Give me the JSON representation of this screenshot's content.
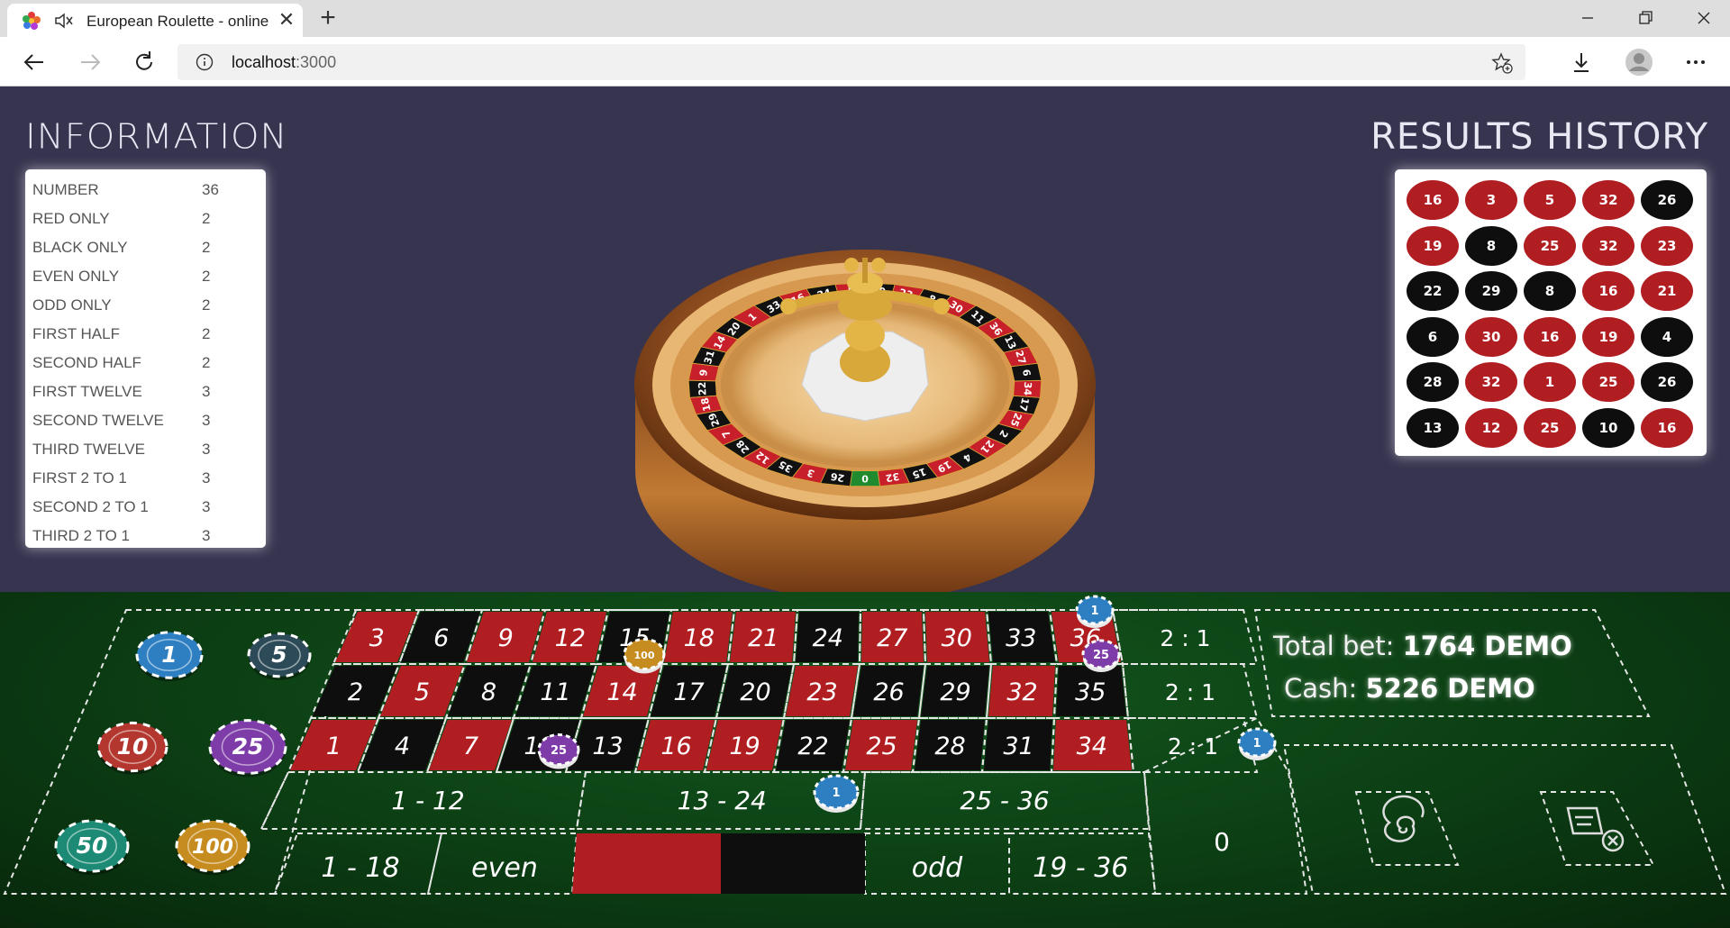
{
  "browser": {
    "tab_title": "European Roulette - online",
    "url_host": "localhost",
    "url_port": ":3000"
  },
  "information": {
    "title": "INFORMATION",
    "rows": [
      {
        "label": "NUMBER",
        "value": "36"
      },
      {
        "label": "RED ONLY",
        "value": "2"
      },
      {
        "label": "BLACK ONLY",
        "value": "2"
      },
      {
        "label": "EVEN ONLY",
        "value": "2"
      },
      {
        "label": "ODD ONLY",
        "value": "2"
      },
      {
        "label": "FIRST HALF",
        "value": "2"
      },
      {
        "label": "SECOND HALF",
        "value": "2"
      },
      {
        "label": "FIRST TWELVE",
        "value": "3"
      },
      {
        "label": "SECOND TWELVE",
        "value": "3"
      },
      {
        "label": "THIRD TWELVE",
        "value": "3"
      },
      {
        "label": "FIRST 2 TO 1",
        "value": "3"
      },
      {
        "label": "SECOND 2 TO 1",
        "value": "3"
      },
      {
        "label": "THIRD 2 TO 1",
        "value": "3"
      }
    ]
  },
  "results_history": {
    "title": "RESULTS HISTORY",
    "rows": [
      [
        {
          "n": "16",
          "c": "red"
        },
        {
          "n": "3",
          "c": "red"
        },
        {
          "n": "5",
          "c": "red"
        },
        {
          "n": "32",
          "c": "red"
        },
        {
          "n": "26",
          "c": "black"
        }
      ],
      [
        {
          "n": "19",
          "c": "red"
        },
        {
          "n": "8",
          "c": "black"
        },
        {
          "n": "25",
          "c": "red"
        },
        {
          "n": "32",
          "c": "red"
        },
        {
          "n": "23",
          "c": "red"
        }
      ],
      [
        {
          "n": "22",
          "c": "black"
        },
        {
          "n": "29",
          "c": "black"
        },
        {
          "n": "8",
          "c": "black"
        },
        {
          "n": "16",
          "c": "red"
        },
        {
          "n": "21",
          "c": "red"
        }
      ],
      [
        {
          "n": "6",
          "c": "black"
        },
        {
          "n": "30",
          "c": "red"
        },
        {
          "n": "16",
          "c": "red"
        },
        {
          "n": "19",
          "c": "red"
        },
        {
          "n": "4",
          "c": "black"
        }
      ],
      [
        {
          "n": "28",
          "c": "black"
        },
        {
          "n": "32",
          "c": "red"
        },
        {
          "n": "1",
          "c": "red"
        },
        {
          "n": "25",
          "c": "red"
        },
        {
          "n": "26",
          "c": "black"
        }
      ],
      [
        {
          "n": "13",
          "c": "black"
        },
        {
          "n": "12",
          "c": "red"
        },
        {
          "n": "25",
          "c": "red"
        },
        {
          "n": "10",
          "c": "black"
        },
        {
          "n": "16",
          "c": "red"
        }
      ]
    ]
  },
  "wheel": {
    "numbers_visible": [
      "0",
      "32",
      "15",
      "19",
      "4",
      "21",
      "2",
      "25",
      "17",
      "34",
      "6",
      "27",
      "13",
      "36",
      "11",
      "30",
      "8",
      "23",
      "10",
      "5",
      "24",
      "16",
      "33",
      "1",
      "20",
      "14",
      "31",
      "9",
      "22",
      "18",
      "29",
      "7",
      "28",
      "12",
      "35",
      "3",
      "26"
    ]
  },
  "table": {
    "rows": [
      [
        {
          "n": "3",
          "c": "red"
        },
        {
          "n": "6",
          "c": "black"
        },
        {
          "n": "9",
          "c": "red"
        },
        {
          "n": "12",
          "c": "red"
        },
        {
          "n": "15",
          "c": "black"
        },
        {
          "n": "18",
          "c": "red"
        },
        {
          "n": "21",
          "c": "red"
        },
        {
          "n": "24",
          "c": "black"
        },
        {
          "n": "27",
          "c": "red"
        },
        {
          "n": "30",
          "c": "red"
        },
        {
          "n": "33",
          "c": "black"
        },
        {
          "n": "36",
          "c": "red"
        }
      ],
      [
        {
          "n": "2",
          "c": "black"
        },
        {
          "n": "5",
          "c": "red"
        },
        {
          "n": "8",
          "c": "black"
        },
        {
          "n": "11",
          "c": "black"
        },
        {
          "n": "14",
          "c": "red"
        },
        {
          "n": "17",
          "c": "black"
        },
        {
          "n": "20",
          "c": "black"
        },
        {
          "n": "23",
          "c": "red"
        },
        {
          "n": "26",
          "c": "black"
        },
        {
          "n": "29",
          "c": "black"
        },
        {
          "n": "32",
          "c": "red"
        },
        {
          "n": "35",
          "c": "black"
        }
      ],
      [
        {
          "n": "1",
          "c": "red"
        },
        {
          "n": "4",
          "c": "black"
        },
        {
          "n": "7",
          "c": "red"
        },
        {
          "n": "10",
          "c": "black"
        },
        {
          "n": "13",
          "c": "black"
        },
        {
          "n": "16",
          "c": "red"
        },
        {
          "n": "19",
          "c": "red"
        },
        {
          "n": "22",
          "c": "black"
        },
        {
          "n": "25",
          "c": "red"
        },
        {
          "n": "28",
          "c": "black"
        },
        {
          "n": "31",
          "c": "black"
        },
        {
          "n": "34",
          "c": "red"
        }
      ]
    ],
    "column_bets": [
      "2 : 1",
      "2 : 1",
      "2 : 1"
    ],
    "dozens": [
      "1 - 12",
      "13 - 24",
      "25 - 36"
    ],
    "zero": "0",
    "outside": {
      "low": "1 - 18",
      "even": "even",
      "odd": "odd",
      "high": "19 - 36"
    },
    "chips_tray": [
      "1",
      "5",
      "10",
      "25",
      "50",
      "100"
    ],
    "placed_chips": [
      {
        "label": "1",
        "spot": "36"
      },
      {
        "label": "25",
        "spot": "35"
      },
      {
        "label": "100",
        "spot": "14"
      },
      {
        "label": "25",
        "spot": "1 - 12"
      },
      {
        "label": "1",
        "spot": "black"
      },
      {
        "label": "1",
        "spot": "zero"
      }
    ],
    "colors": {
      "red": "#b01e22",
      "black": "#0e0e0e",
      "felt": "#0e4a17"
    }
  },
  "status": {
    "total_bet_label": "Total bet:",
    "total_bet_value": "1764 DEMO",
    "cash_label": "Cash:",
    "cash_value": "5226 DEMO"
  },
  "controls": {
    "spin_icon": "spiral-icon",
    "clear_icon": "clear-bets-icon"
  }
}
